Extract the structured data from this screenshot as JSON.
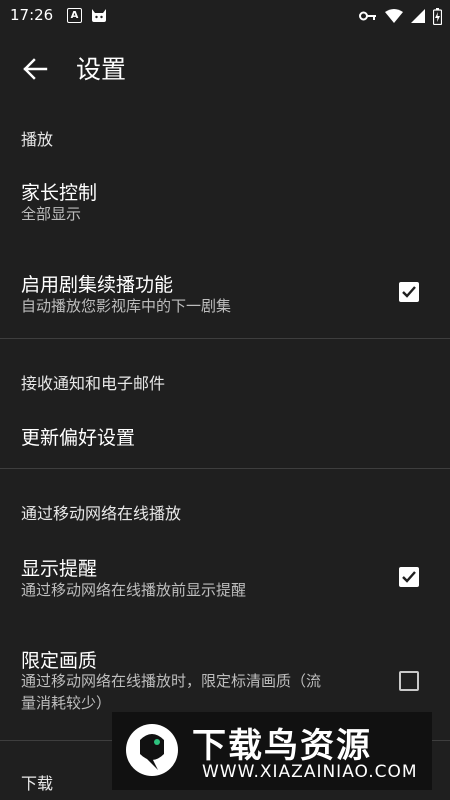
{
  "statusbar": {
    "time": "17:26",
    "notif_a": "A"
  },
  "header": {
    "title": "设置"
  },
  "sections": {
    "playback": {
      "label": "播放",
      "parental": {
        "title": "家长控制",
        "subtitle": "全部显示"
      },
      "autoplay": {
        "title": "启用剧集续播功能",
        "subtitle": "自动播放您影视库中的下一剧集",
        "checked": true
      }
    },
    "notifications": {
      "label": "接收通知和电子邮件",
      "prefs": {
        "title": "更新偏好设置"
      }
    },
    "mobile": {
      "label": "通过移动网络在线播放",
      "reminder": {
        "title": "显示提醒",
        "subtitle": "通过移动网络在线播放前显示提醒",
        "checked": true
      },
      "quality": {
        "title": "限定画质",
        "subtitle_line1": "通过移动网络在线播放时，限定标清画质（流",
        "subtitle_line2": "量消耗较少）",
        "checked": false
      }
    },
    "downloads": {
      "label": "下载"
    }
  },
  "watermark": {
    "cn": "下载鸟资源",
    "url": "WWW.XIAZAINIAO.COM"
  },
  "colors": {
    "background": "#1f1f1f",
    "divider": "#3e3e3e",
    "text_primary": "#ffffff",
    "text_secondary": "#bdbdbd"
  }
}
